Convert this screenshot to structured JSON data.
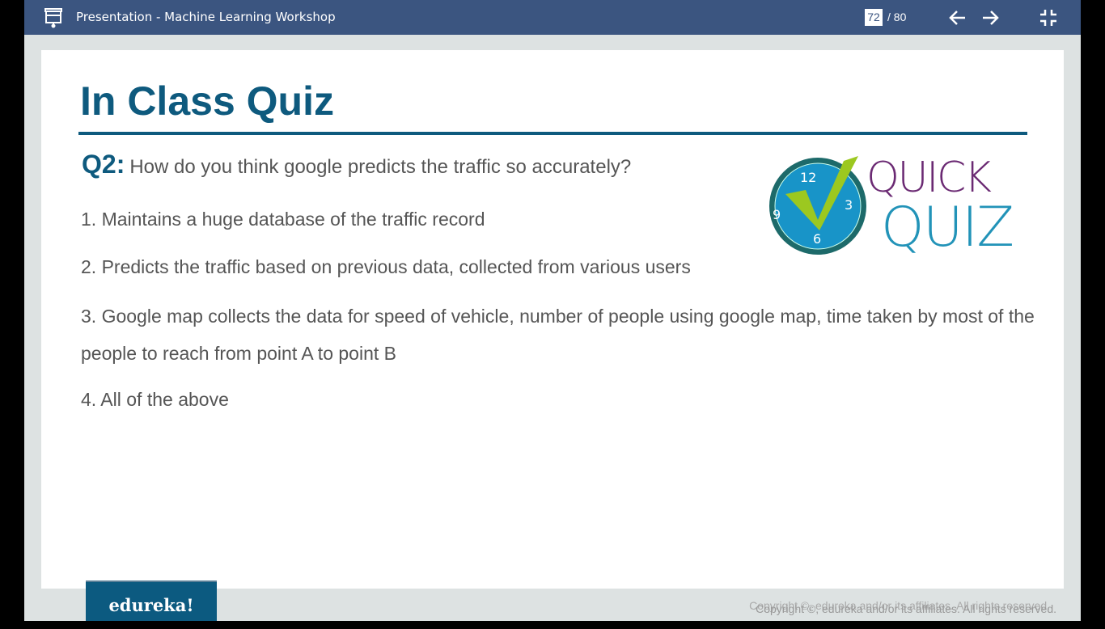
{
  "header": {
    "title": "Presentation - Machine Learning Workshop",
    "current_page": "72",
    "total_pages": "/ 80"
  },
  "slide": {
    "title": "In Class Quiz",
    "question_label": "Q2:",
    "question": "How do you think google predicts the traffic so accurately?",
    "options": [
      "1. Maintains a huge database of the traffic record",
      "2. Predicts the traffic based on previous data, collected from various users",
      "3. Google map collects the data for speed of vehicle, number of people using google map, time taken by most of the people to reach from point A to point B",
      "4. All of the above"
    ],
    "logo": {
      "line1": "QUICK",
      "line2": "QUIZ"
    }
  },
  "footer": {
    "brand": "edureka!",
    "copyright": "Copyright ©, edureka and/or its affiliates. All rights reserved."
  }
}
